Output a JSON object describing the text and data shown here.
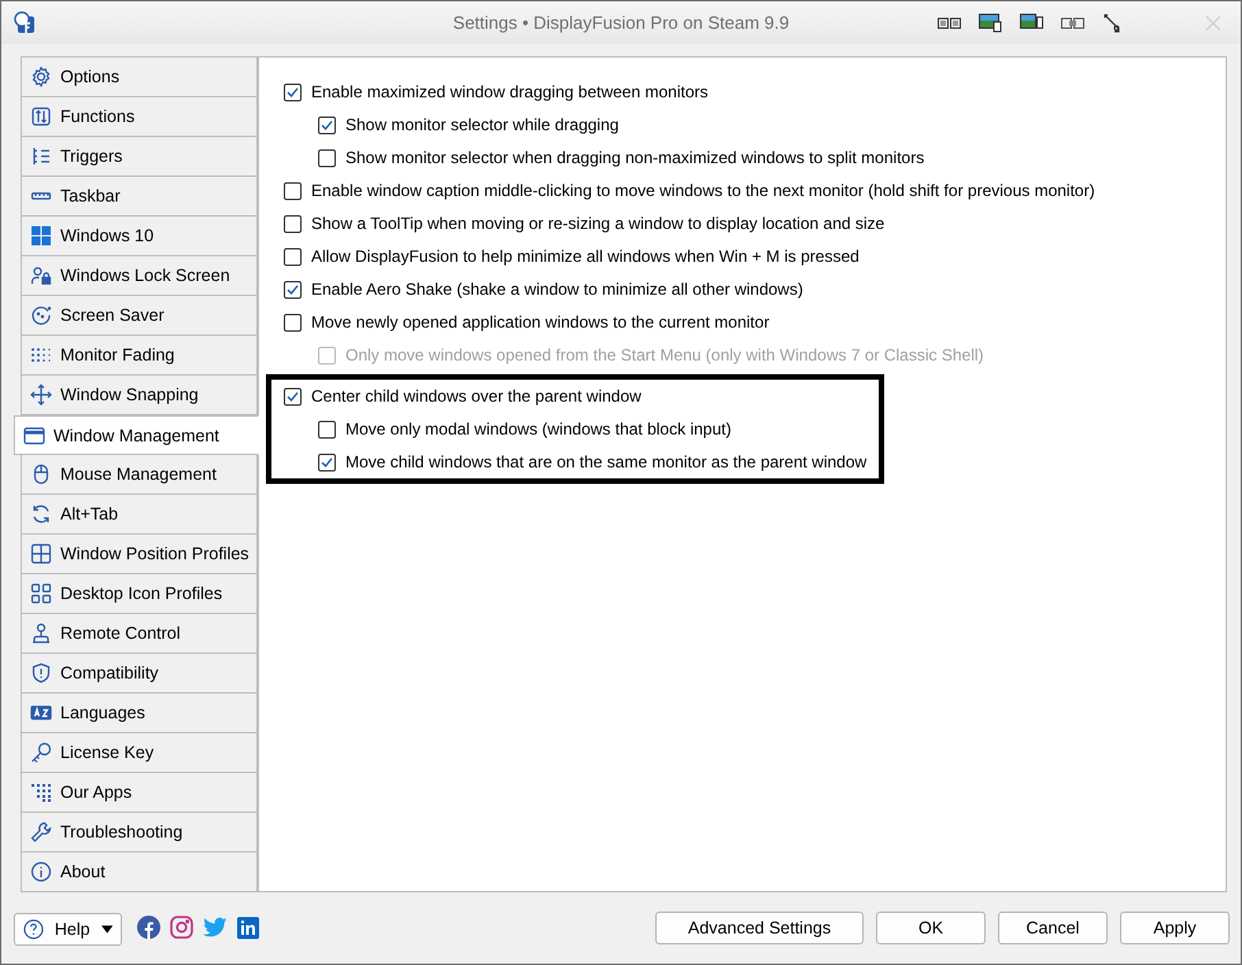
{
  "window": {
    "title": "Settings • DisplayFusion Pro on Steam 9.9"
  },
  "sidebar": {
    "items": [
      {
        "label": "Options",
        "selected": false
      },
      {
        "label": "Functions",
        "selected": false
      },
      {
        "label": "Triggers",
        "selected": false
      },
      {
        "label": "Taskbar",
        "selected": false
      },
      {
        "label": "Windows 10",
        "selected": false
      },
      {
        "label": "Windows Lock Screen",
        "selected": false
      },
      {
        "label": "Screen Saver",
        "selected": false
      },
      {
        "label": "Monitor Fading",
        "selected": false
      },
      {
        "label": "Window Snapping",
        "selected": false
      },
      {
        "label": "Window Management",
        "selected": true
      },
      {
        "label": "Mouse Management",
        "selected": false
      },
      {
        "label": "Alt+Tab",
        "selected": false
      },
      {
        "label": "Window Position Profiles",
        "selected": false
      },
      {
        "label": "Desktop Icon Profiles",
        "selected": false
      },
      {
        "label": "Remote Control",
        "selected": false
      },
      {
        "label": "Compatibility",
        "selected": false
      },
      {
        "label": "Languages",
        "selected": false
      },
      {
        "label": "License Key",
        "selected": false
      },
      {
        "label": "Our Apps",
        "selected": false
      },
      {
        "label": "Troubleshooting",
        "selected": false
      },
      {
        "label": "About",
        "selected": false
      }
    ]
  },
  "options": [
    {
      "label": "Enable maximized window dragging between monitors",
      "checked": true,
      "disabled": false,
      "highlighted": false,
      "children": [
        {
          "label": "Show monitor selector while dragging",
          "checked": true,
          "disabled": false
        },
        {
          "label": "Show monitor selector when dragging non-maximized windows to split monitors",
          "checked": false,
          "disabled": false
        }
      ]
    },
    {
      "label": "Enable window caption middle-clicking to move windows to the next monitor (hold shift for previous monitor)",
      "checked": false,
      "disabled": false,
      "highlighted": false
    },
    {
      "label": "Show a ToolTip when moving or re-sizing a window to display location and size",
      "checked": false,
      "disabled": false,
      "highlighted": false
    },
    {
      "label": "Allow DisplayFusion to help minimize all windows when Win + M is pressed",
      "checked": false,
      "disabled": false,
      "highlighted": false
    },
    {
      "label": "Enable Aero Shake (shake a window to minimize all other windows)",
      "checked": true,
      "disabled": false,
      "highlighted": false
    },
    {
      "label": "Move newly opened application windows to the current monitor",
      "checked": false,
      "disabled": false,
      "highlighted": false,
      "children": [
        {
          "label": "Only move windows opened from the Start Menu (only with Windows 7 or Classic Shell)",
          "checked": false,
          "disabled": true
        }
      ]
    },
    {
      "label": "Center child windows over the parent window",
      "checked": true,
      "disabled": false,
      "highlighted": true,
      "children": [
        {
          "label": "Move only modal windows (windows that block input)",
          "checked": false,
          "disabled": false
        },
        {
          "label": "Move child windows that are on the same monitor as the parent window",
          "checked": true,
          "disabled": false
        }
      ]
    }
  ],
  "footer": {
    "help": "Help",
    "buttons": [
      "Advanced Settings",
      "OK",
      "Cancel",
      "Apply"
    ]
  }
}
